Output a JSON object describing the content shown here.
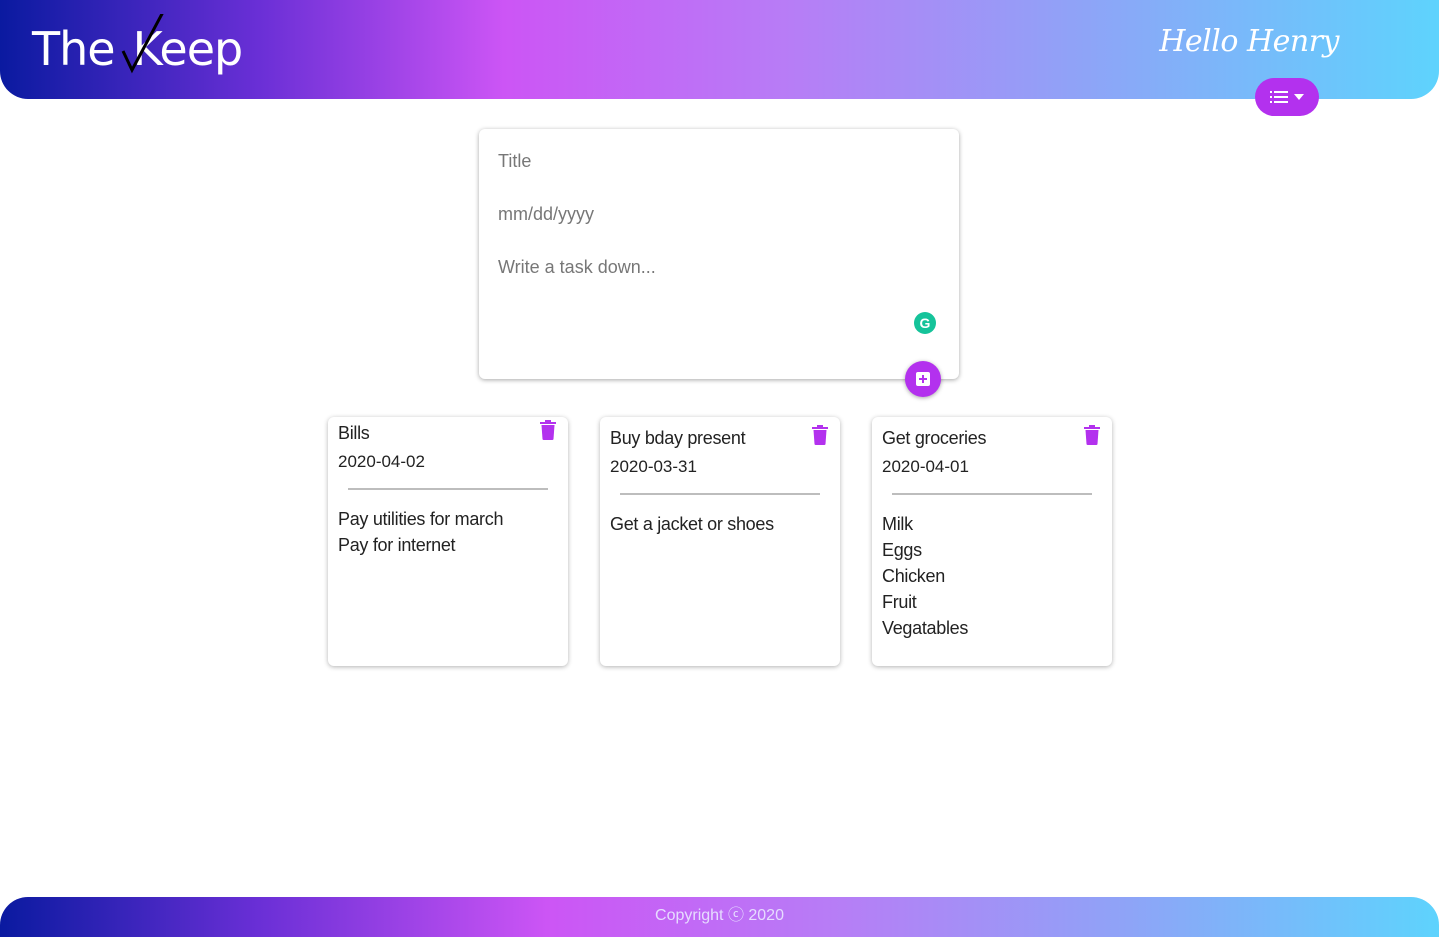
{
  "header": {
    "logo_text_left": "The",
    "logo_text_right": "Keep",
    "greeting": "Hello Henry"
  },
  "composer": {
    "title_placeholder": "Title",
    "date_placeholder": "mm/dd/yyyy",
    "task_placeholder": "Write a task down...",
    "grammarly_badge": "G"
  },
  "notes": [
    {
      "title": "Bills",
      "date": "2020-04-02",
      "lines": [
        "Pay utilities for march",
        "Pay for internet"
      ]
    },
    {
      "title": "Buy bday present",
      "date": "2020-03-31",
      "lines": [
        "Get a jacket or shoes"
      ]
    },
    {
      "title": "Get groceries",
      "date": "2020-04-01",
      "lines": [
        "Milk",
        "Eggs",
        "Chicken",
        "Fruit",
        "Vegatables"
      ]
    }
  ],
  "footer": {
    "copyright": "Copyright ⓒ 2020"
  },
  "colors": {
    "accent": "#b331ee",
    "gradient_start": "#0a1aa0",
    "gradient_mid": "#cc55f5",
    "gradient_end": "#5ed3fd"
  },
  "icons": {
    "menu": "list-icon",
    "add": "plus-square-icon",
    "delete": "trash-icon"
  }
}
